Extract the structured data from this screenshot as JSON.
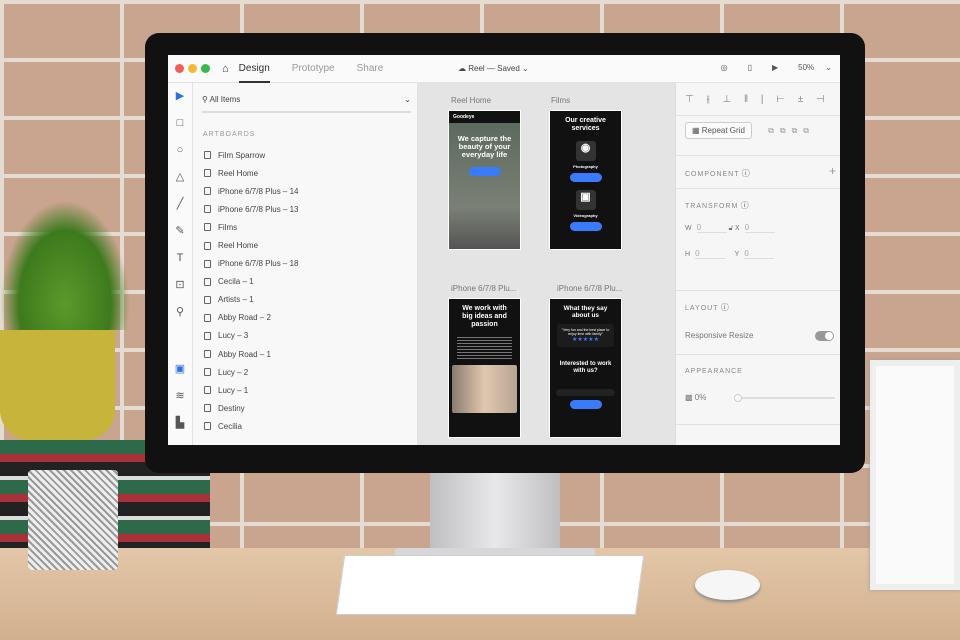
{
  "titlebar": {
    "tabs": [
      "Design",
      "Prototype",
      "Share"
    ],
    "doc": "Reel — Saved",
    "zoom": "50%"
  },
  "left": {
    "search": "All Items",
    "section": "ARTBOARDS",
    "items": [
      "Film Sparrow",
      "Reel Home",
      "iPhone 6/7/8 Plus – 14",
      "iPhone 6/7/8 Plus – 13",
      "Films",
      "Reel Home",
      "iPhone 6/7/8 Plus – 18",
      "Cecila – 1",
      "Artists – 1",
      "Abby Road – 2",
      "Lucy – 3",
      "Abby Road – 1",
      "Lucy – 2",
      "Lucy – 1",
      "Destiny",
      "Cecilia"
    ]
  },
  "canvas": {
    "labels": [
      "Reel Home",
      "Films",
      "iPhone 6/7/8 Plu...",
      "iPhone 6/7/8 Plu..."
    ],
    "reel": {
      "brand": "Goodeye",
      "headline": "We capture the beauty of your everyday life"
    },
    "films": {
      "headline": "Our creative services",
      "s1": "Photography",
      "s2": "Videography"
    },
    "ideas": {
      "headline": "We work with big ideas and passion"
    },
    "say": {
      "headline": "What they say about us",
      "quote": "\"Very fun and the best place to enjoy time with family\"",
      "stars": "★★★★★",
      "cta": "Interested to work with us?"
    }
  },
  "right": {
    "repeat": "Repeat Grid",
    "component": "COMPONENT",
    "transform": "TRANSFORM",
    "w": "0",
    "h": "0",
    "x": "0",
    "y": "0",
    "layout": "LAYOUT",
    "resize": "Responsive Resize",
    "appearance": "APPEARANCE",
    "opacity": "0%"
  },
  "colors": {
    "accent": "#3a7bfd"
  }
}
